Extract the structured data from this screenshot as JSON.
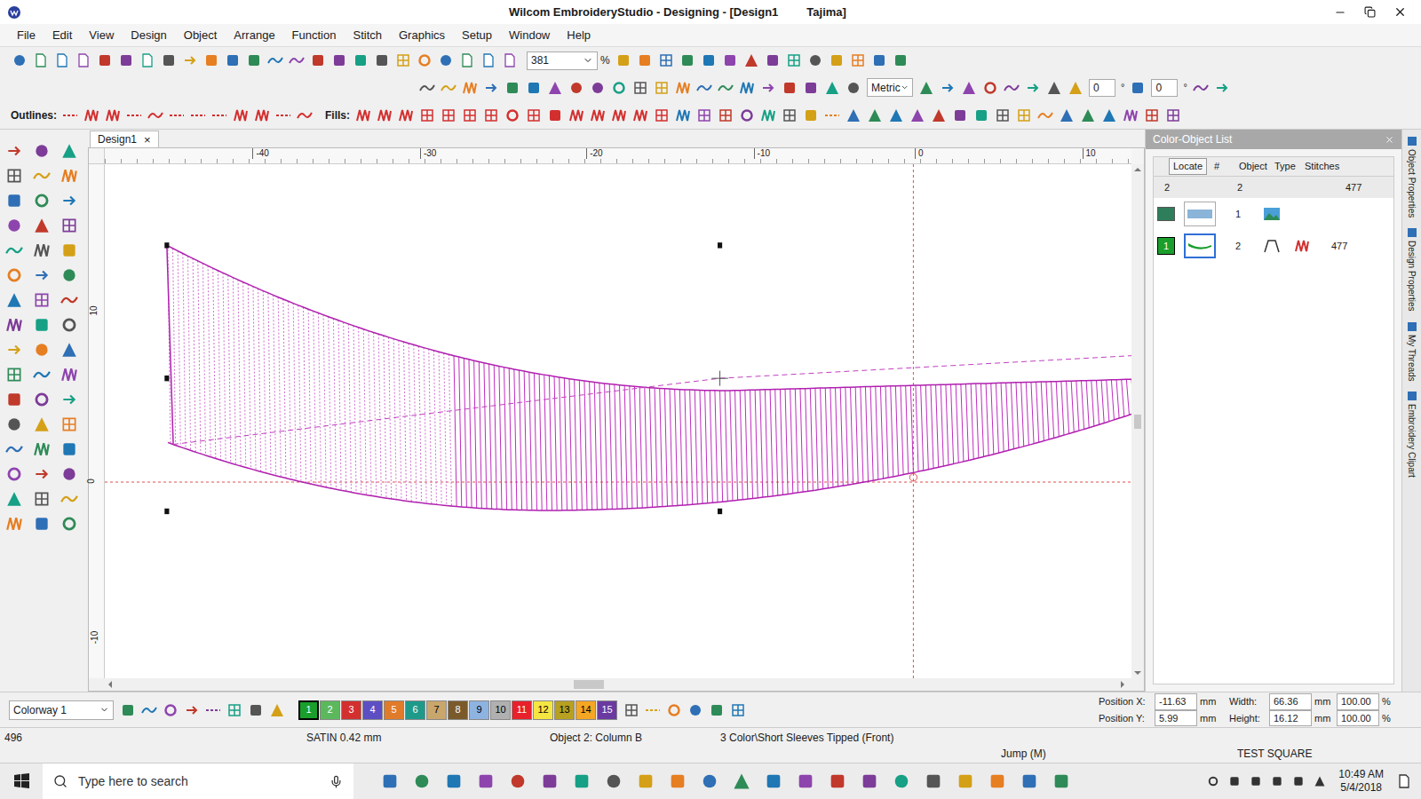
{
  "window": {
    "title": "Wilcom EmbroideryStudio - Designing - [Design1",
    "title_extra": "Tajima]"
  },
  "menu": [
    "File",
    "Edit",
    "View",
    "Design",
    "Object",
    "Arrange",
    "Function",
    "Stitch",
    "Graphics",
    "Setup",
    "Window",
    "Help"
  ],
  "toolbar": {
    "zoom": "381",
    "zoom_unit": "%",
    "units": "Metric",
    "angle_1": "0",
    "angle_2": "0",
    "degree": "°",
    "outlines_label": "Outlines:",
    "fills_label": "Fills:"
  },
  "document_tab": {
    "label": "Design1",
    "close": "×",
    "selected": true
  },
  "rulers": {
    "top": [
      "-40",
      "-30",
      "-20",
      "-10",
      "0",
      "10"
    ],
    "left": [
      "10",
      "0",
      "-10"
    ]
  },
  "color_object_list": {
    "title": "Color-Object List",
    "locate": "Locate",
    "columns": [
      "#",
      "Object",
      "Type",
      "Stitches"
    ],
    "summary": {
      "colors": "2",
      "objects": "2",
      "stitches": "477"
    },
    "rows": [
      {
        "kind": "image",
        "color_label": "",
        "number": "1",
        "stitches": "",
        "selected": false,
        "color": "#2e7d5b"
      },
      {
        "kind": "satin",
        "color_label": "1",
        "number": "2",
        "stitches": "477",
        "selected": true,
        "color": "#1a9e2c"
      }
    ]
  },
  "side_tabs": [
    "Object Properties",
    "Design Properties",
    "My Threads",
    "Embroidery Clipart"
  ],
  "color_bar": {
    "colorway": "Colorway 1",
    "chips": [
      {
        "label": "1",
        "color": "#1a9e2c",
        "selected": true
      },
      {
        "label": "2",
        "color": "#5cb85c",
        "selected": false
      },
      {
        "label": "3",
        "color": "#d32f2f",
        "selected": false
      },
      {
        "label": "4",
        "color": "#5c4fc4",
        "selected": false
      },
      {
        "label": "5",
        "color": "#e07b2a",
        "selected": false
      },
      {
        "label": "6",
        "color": "#1e9a8a",
        "selected": false
      },
      {
        "label": "7",
        "color": "#c9a66b",
        "selected": false
      },
      {
        "label": "8",
        "color": "#7a5a2a",
        "selected": false
      },
      {
        "label": "9",
        "color": "#8fb3e0",
        "selected": false
      },
      {
        "label": "10",
        "color": "#b0b0b0",
        "selected": false
      },
      {
        "label": "11",
        "color": "#e8212b",
        "selected": false
      },
      {
        "label": "12",
        "color": "#f5e642",
        "selected": false
      },
      {
        "label": "13",
        "color": "#b8a020",
        "selected": false
      },
      {
        "label": "14",
        "color": "#f5a623",
        "selected": false
      },
      {
        "label": "15",
        "color": "#6a3aa0",
        "selected": false
      }
    ]
  },
  "position": {
    "x_label": "Position X:",
    "x": "-11.63",
    "y_label": "Position Y:",
    "y": "5.99",
    "unit": "mm",
    "width_label": "Width:",
    "width": "66.36",
    "height_label": "Height:",
    "height": "16.12",
    "width_pct": "100.00",
    "height_pct": "100.00",
    "pct": "%"
  },
  "status_bar": {
    "stitch_count": "496",
    "stitch_type": "SATIN 0.42 mm",
    "object": "Object 2: Column B",
    "design": "3 Color\\Short Sleeves Tipped (Front)",
    "mode": "Jump (M)",
    "machine": "TEST SQUARE"
  },
  "taskbar": {
    "search": "Type here to search",
    "time": "10:49 AM",
    "date": "5/4/2018"
  }
}
